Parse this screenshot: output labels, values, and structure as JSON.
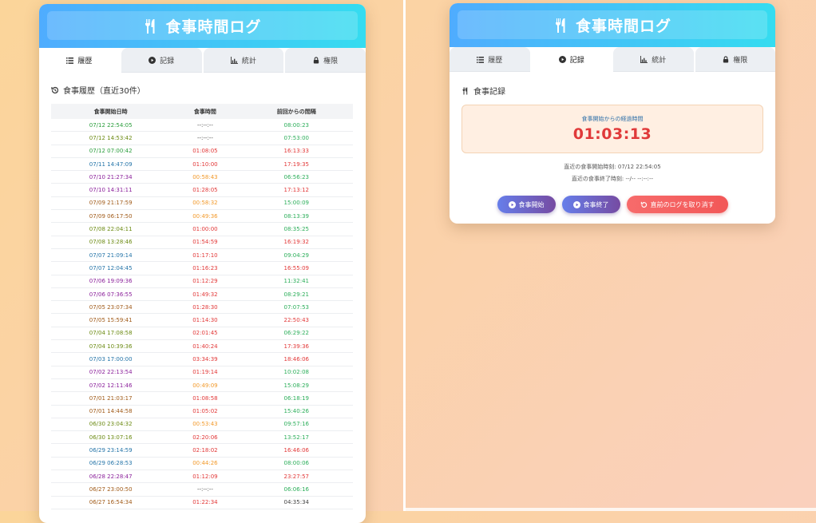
{
  "app": {
    "title": "食事時間ログ",
    "colors": {
      "header_start": "#4facfe",
      "header_end": "#35dcf0",
      "accent": "#764ba2",
      "danger": "#f25757"
    }
  },
  "tabs": [
    {
      "label": "履歴",
      "icon": "list-icon"
    },
    {
      "label": "記録",
      "icon": "play-circle-icon"
    },
    {
      "label": "統計",
      "icon": "chart-icon"
    },
    {
      "label": "権限",
      "icon": "lock-icon"
    }
  ],
  "history": {
    "title": "食事履歴（直近30件）",
    "columns": [
      "食事開始日時",
      "食事時間",
      "前回からの間隔"
    ],
    "rows": [
      {
        "start": "07/12 22:54:05",
        "duration": "--:--:--",
        "interval": "08:00:23",
        "sc": "c-green",
        "dc": "c-gray",
        "ic": "c-teal"
      },
      {
        "start": "07/12 14:53:42",
        "duration": "--:--:--",
        "interval": "07:53:00",
        "sc": "c-olive",
        "dc": "c-gray",
        "ic": "c-teal"
      },
      {
        "start": "07/12 07:00:42",
        "duration": "01:08:05",
        "interval": "16:13:33",
        "sc": "c-green",
        "dc": "c-red",
        "ic": "c-red"
      },
      {
        "start": "07/11 14:47:09",
        "duration": "01:10:00",
        "interval": "17:19:35",
        "sc": "c-blue",
        "dc": "c-red",
        "ic": "c-red"
      },
      {
        "start": "07/10 21:27:34",
        "duration": "00:58:43",
        "interval": "06:56:23",
        "sc": "c-purple",
        "dc": "c-orange",
        "ic": "c-teal"
      },
      {
        "start": "07/10 14:31:11",
        "duration": "01:28:05",
        "interval": "17:13:12",
        "sc": "c-purple",
        "dc": "c-red",
        "ic": "c-red"
      },
      {
        "start": "07/09 21:17:59",
        "duration": "00:58:32",
        "interval": "15:00:09",
        "sc": "c-brown",
        "dc": "c-orange",
        "ic": "c-teal"
      },
      {
        "start": "07/09 06:17:50",
        "duration": "00:49:36",
        "interval": "08:13:39",
        "sc": "c-brown",
        "dc": "c-orange",
        "ic": "c-teal"
      },
      {
        "start": "07/08 22:04:11",
        "duration": "01:00:00",
        "interval": "08:35:25",
        "sc": "c-olive",
        "dc": "c-red",
        "ic": "c-teal"
      },
      {
        "start": "07/08 13:28:46",
        "duration": "01:54:59",
        "interval": "16:19:32",
        "sc": "c-olive",
        "dc": "c-red",
        "ic": "c-red"
      },
      {
        "start": "07/07 21:09:14",
        "duration": "01:17:10",
        "interval": "09:04:29",
        "sc": "c-blue",
        "dc": "c-red",
        "ic": "c-teal"
      },
      {
        "start": "07/07 12:04:45",
        "duration": "01:16:23",
        "interval": "16:55:09",
        "sc": "c-blue",
        "dc": "c-red",
        "ic": "c-red"
      },
      {
        "start": "07/06 19:09:36",
        "duration": "01:12:29",
        "interval": "11:32:41",
        "sc": "c-purple",
        "dc": "c-red",
        "ic": "c-teal"
      },
      {
        "start": "07/06 07:36:55",
        "duration": "01:49:32",
        "interval": "08:29:21",
        "sc": "c-purple",
        "dc": "c-red",
        "ic": "c-teal"
      },
      {
        "start": "07/05 23:07:34",
        "duration": "01:28:30",
        "interval": "07:07:53",
        "sc": "c-brown",
        "dc": "c-red",
        "ic": "c-teal"
      },
      {
        "start": "07/05 15:59:41",
        "duration": "01:14:30",
        "interval": "22:50:43",
        "sc": "c-brown",
        "dc": "c-red",
        "ic": "c-red"
      },
      {
        "start": "07/04 17:08:58",
        "duration": "02:01:45",
        "interval": "06:29:22",
        "sc": "c-olive",
        "dc": "c-red",
        "ic": "c-teal"
      },
      {
        "start": "07/04 10:39:36",
        "duration": "01:40:24",
        "interval": "17:39:36",
        "sc": "c-olive",
        "dc": "c-red",
        "ic": "c-red"
      },
      {
        "start": "07/03 17:00:00",
        "duration": "03:34:39",
        "interval": "18:46:06",
        "sc": "c-blue",
        "dc": "c-red",
        "ic": "c-red"
      },
      {
        "start": "07/02 22:13:54",
        "duration": "01:19:14",
        "interval": "10:02:08",
        "sc": "c-purple",
        "dc": "c-red",
        "ic": "c-teal"
      },
      {
        "start": "07/02 12:11:46",
        "duration": "00:49:09",
        "interval": "15:08:29",
        "sc": "c-purple",
        "dc": "c-orange",
        "ic": "c-teal"
      },
      {
        "start": "07/01 21:03:17",
        "duration": "01:08:58",
        "interval": "06:18:19",
        "sc": "c-brown",
        "dc": "c-red",
        "ic": "c-teal"
      },
      {
        "start": "07/01 14:44:58",
        "duration": "01:05:02",
        "interval": "15:40:26",
        "sc": "c-brown",
        "dc": "c-red",
        "ic": "c-teal"
      },
      {
        "start": "06/30 23:04:32",
        "duration": "00:53:43",
        "interval": "09:57:16",
        "sc": "c-olive",
        "dc": "c-orange",
        "ic": "c-teal"
      },
      {
        "start": "06/30 13:07:16",
        "duration": "02:20:06",
        "interval": "13:52:17",
        "sc": "c-olive",
        "dc": "c-red",
        "ic": "c-teal"
      },
      {
        "start": "06/29 23:14:59",
        "duration": "02:18:02",
        "interval": "16:46:06",
        "sc": "c-blue",
        "dc": "c-red",
        "ic": "c-red"
      },
      {
        "start": "06/29 06:28:53",
        "duration": "00:44:26",
        "interval": "08:00:06",
        "sc": "c-blue",
        "dc": "c-orange",
        "ic": "c-teal"
      },
      {
        "start": "06/28 22:28:47",
        "duration": "01:12:09",
        "interval": "23:27:57",
        "sc": "c-purple",
        "dc": "c-red",
        "ic": "c-red"
      },
      {
        "start": "06/27 23:00:50",
        "duration": "--:--:--",
        "interval": "06:06:16",
        "sc": "c-brown",
        "dc": "c-gray",
        "ic": "c-teal"
      },
      {
        "start": "06/27 16:54:34",
        "duration": "01:22:34",
        "interval": "04:35:34",
        "sc": "c-brown",
        "dc": "c-red",
        "ic": "c-gray"
      }
    ]
  },
  "record": {
    "title": "食事記録",
    "elapsed_label": "食事開始からの経過時間",
    "elapsed_time": "01:03:13",
    "last_start": "直近の食事開始時刻: 07/12 22:54:05",
    "last_end": "直近の食事終了時刻: --/-- --:--:--",
    "buttons": {
      "start": "食事開始",
      "end": "食事終了",
      "undo": "直前のログを取り消す"
    }
  }
}
